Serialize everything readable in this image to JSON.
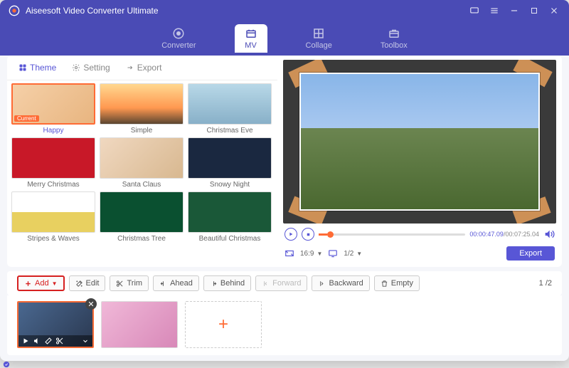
{
  "app": {
    "title": "Aiseesoft Video Converter Ultimate"
  },
  "tabs": [
    {
      "label": "Converter"
    },
    {
      "label": "MV"
    },
    {
      "label": "Collage"
    },
    {
      "label": "Toolbox"
    }
  ],
  "subtabs": {
    "theme": "Theme",
    "setting": "Setting",
    "export": "Export"
  },
  "themes": [
    {
      "label": "Happy",
      "badge": "Current",
      "cls": "bg-happy",
      "current": true
    },
    {
      "label": "Simple",
      "cls": "bg-simple"
    },
    {
      "label": "Christmas Eve",
      "cls": "bg-ceve"
    },
    {
      "label": "Merry Christmas",
      "cls": "bg-merry"
    },
    {
      "label": "Santa Claus",
      "cls": "bg-santa"
    },
    {
      "label": "Snowy Night",
      "cls": "bg-snowy"
    },
    {
      "label": "Stripes & Waves",
      "cls": "bg-stripes"
    },
    {
      "label": "Christmas Tree",
      "cls": "bg-ctree"
    },
    {
      "label": "Beautiful Christmas",
      "cls": "bg-bchrist"
    }
  ],
  "player": {
    "elapsed": "00:00:47.09",
    "duration": "00:07:25.04",
    "ratio": "16:9",
    "zoom": "1/2"
  },
  "export_label": "Export",
  "toolbar": {
    "add": "Add",
    "edit": "Edit",
    "trim": "Trim",
    "ahead": "Ahead",
    "behind": "Behind",
    "forward": "Forward",
    "backward": "Backward",
    "empty": "Empty"
  },
  "pager": "1 /2"
}
